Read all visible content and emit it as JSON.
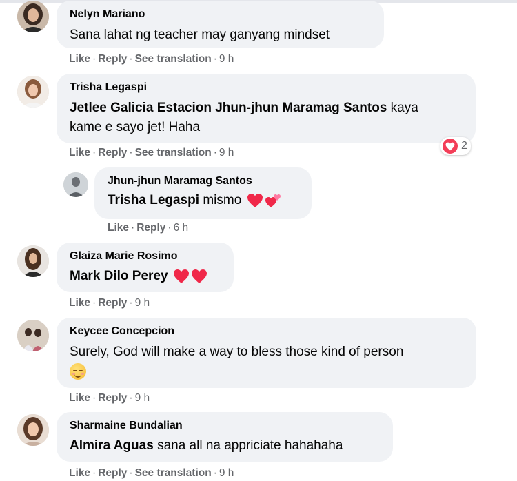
{
  "comments": [
    {
      "name": "Nelyn Mariano",
      "text": "Sana lahat ng teacher may ganyang mindset",
      "actions": {
        "like": "Like",
        "reply": "Reply",
        "translate": "See translation",
        "time": "9 h"
      }
    },
    {
      "name": "Trisha Legaspi",
      "tag1": "Jetlee Galicia Estacion",
      "tag2": "Jhun-jhun Maramag Santos",
      "text_line1_rest": "kaya",
      "text_line2": "kame e sayo jet! Haha",
      "actions": {
        "like": "Like",
        "reply": "Reply",
        "translate": "See translation",
        "time": "9 h"
      },
      "reaction_count": "2",
      "reaction_icon": "heart-reaction-icon"
    },
    {
      "name": "Jhun-jhun Maramag Santos",
      "tag": "Trisha Legaspi",
      "text": "mismo",
      "actions": {
        "like": "Like",
        "reply": "Reply",
        "time": "6 h"
      }
    },
    {
      "name": "Glaiza Marie Rosimo",
      "tag": "Mark Dilo Perey",
      "actions": {
        "like": "Like",
        "reply": "Reply",
        "time": "9 h"
      }
    },
    {
      "name": "Keycee Concepcion",
      "text_line1": "Surely, God will make a way to bless those kind of person",
      "actions": {
        "like": "Like",
        "reply": "Reply",
        "time": "9 h"
      }
    },
    {
      "name": "Sharmaine Bundalian",
      "tag": "Almira Aguas",
      "text": "sana all na appriciate hahahaha",
      "actions": {
        "like": "Like",
        "reply": "Reply",
        "translate": "See translation",
        "time": "9 h"
      }
    }
  ],
  "separator": "·",
  "colors": {
    "bubble": "#f0f2f5",
    "action": "#65676b",
    "heart": "#f02849",
    "reaction": "#f33e58"
  }
}
